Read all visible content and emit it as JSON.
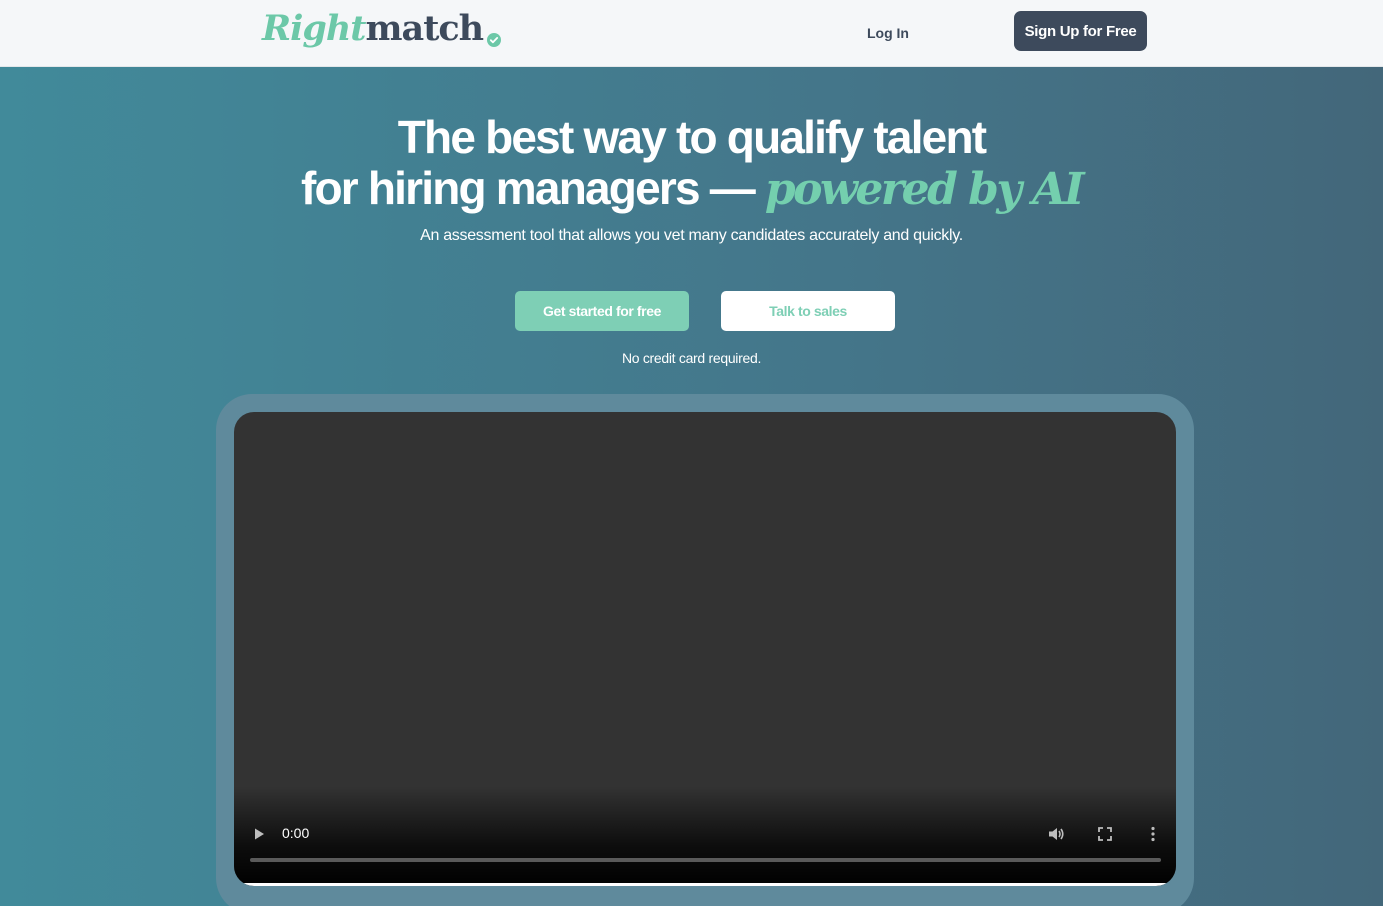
{
  "nav": {
    "logo_part1": "Right",
    "logo_part2": "match",
    "login_label": "Log In",
    "signup_label": "Sign Up for Free"
  },
  "hero": {
    "title_line1": "The best way to qualify talent",
    "title_line2": "for hiring managers — ",
    "title_accent": "powered by AI",
    "subtitle": "An assessment tool that allows you vet many candidates accurately and quickly.",
    "primary_cta": "Get started for free",
    "secondary_cta": "Talk to sales",
    "note": "No credit card required."
  },
  "video": {
    "time": "0:00",
    "progress": 0
  },
  "colors": {
    "accent": "#74cfae",
    "dark": "#3d4a5c",
    "background": "#418a9a"
  },
  "icons": {
    "logo_check": "check-circle-icon",
    "play": "play-icon",
    "volume": "volume-icon",
    "fullscreen": "fullscreen-icon",
    "more": "more-vertical-icon"
  }
}
